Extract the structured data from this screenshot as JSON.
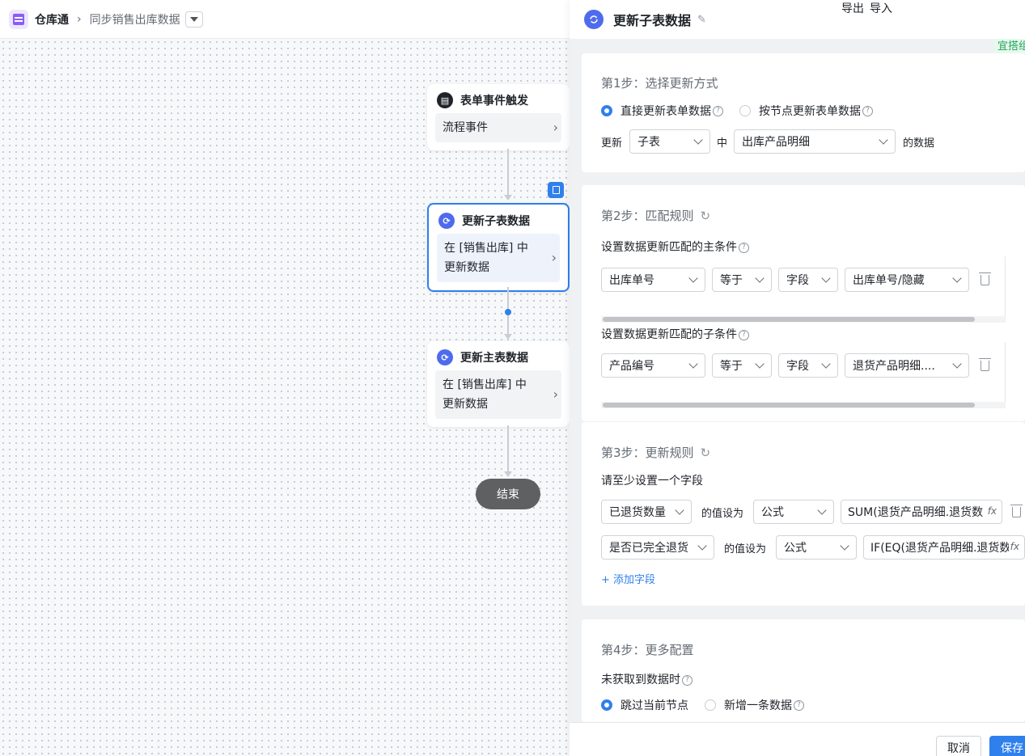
{
  "topbar": {
    "app_name": "仓库通",
    "flow_name": "同步销售出库数据"
  },
  "canvas": {
    "nodes": [
      {
        "title": "表单事件触发",
        "body": "流程事件"
      },
      {
        "title": "更新子表数据",
        "body": "在 [销售出库] 中更新数据"
      },
      {
        "title": "更新主表数据",
        "body": "在 [销售出库] 中更新数据"
      }
    ],
    "end_label": "结束"
  },
  "panel": {
    "title": "更新子表数据",
    "export_label": "导出",
    "import_label": "导入",
    "badge": "宜搭组",
    "step1": {
      "title": "第1步：选择更新方式",
      "option_direct": "直接更新表单数据",
      "option_by_node": "按节点更新表单数据",
      "update_label": "更新",
      "target_type": "子表",
      "in_label": "中",
      "subtable": "出库产品明细",
      "data_suffix": "的数据"
    },
    "step2": {
      "title": "第2步：匹配规则",
      "main_condition_label": "设置数据更新匹配的主条件",
      "main_condition": {
        "field": "出库单号",
        "operator": "等于",
        "value_type": "字段",
        "value": "出库单号/隐藏"
      },
      "sub_condition_label": "设置数据更新匹配的子条件",
      "sub_condition": {
        "field": "产品编号",
        "operator": "等于",
        "value_type": "字段",
        "value": "退货产品明细...."
      }
    },
    "step3": {
      "title": "第3步：更新规则",
      "hint": "请至少设置一个字段",
      "rules": [
        {
          "field": "已退货数量",
          "set_label": "的值设为",
          "mode": "公式",
          "formula": "SUM(退货产品明细.退货数"
        },
        {
          "field": "是否已完全退货",
          "set_label": "的值设为",
          "mode": "公式",
          "formula": "IF(EQ(退货产品明细.退货数"
        }
      ],
      "add_field": "+ 添加字段"
    },
    "step4": {
      "title": "第4步：更多配置",
      "no_data_label": "未获取到数据时",
      "option_skip": "跳过当前节点",
      "option_add": "新增一条数据"
    },
    "footer": {
      "cancel": "取消",
      "save": "保存"
    }
  }
}
